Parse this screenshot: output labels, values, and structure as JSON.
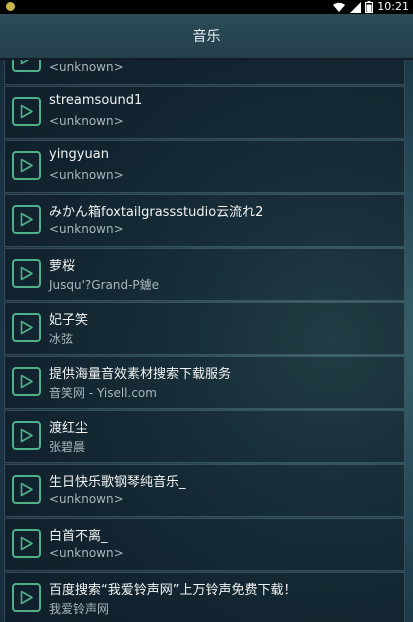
{
  "status_bar": {
    "time": "10:21",
    "battery_level": "82"
  },
  "header": {
    "title": "音乐"
  },
  "songs": [
    {
      "name": "",
      "artist": "<unknown>"
    },
    {
      "name": "streamsound1",
      "artist": "<unknown>"
    },
    {
      "name": "yingyuan",
      "artist": "<unknown>"
    },
    {
      "name": "みかん箱foxtailgrassstudio云流れ2",
      "artist": "<unknown>"
    },
    {
      "name": "萝桜",
      "artist": "Jusqu'?Grand-P鐪e"
    },
    {
      "name": "妃子笑",
      "artist": "冰弦"
    },
    {
      "name": "提供海量音效素材搜索下载服务",
      "artist": "音笑网 - Yisell.com"
    },
    {
      "name": "渡红尘",
      "artist": "张碧晨"
    },
    {
      "name": "生日快乐歌钢琴纯音乐_",
      "artist": "<unknown>"
    },
    {
      "name": "白首不离_",
      "artist": "<unknown>"
    },
    {
      "name": "百度搜索“我爱铃声网”上万铃声免费下载！",
      "artist": "我爱铃声网"
    }
  ],
  "icons": {
    "play": "play-icon",
    "accent_color": "#4fb08a"
  }
}
